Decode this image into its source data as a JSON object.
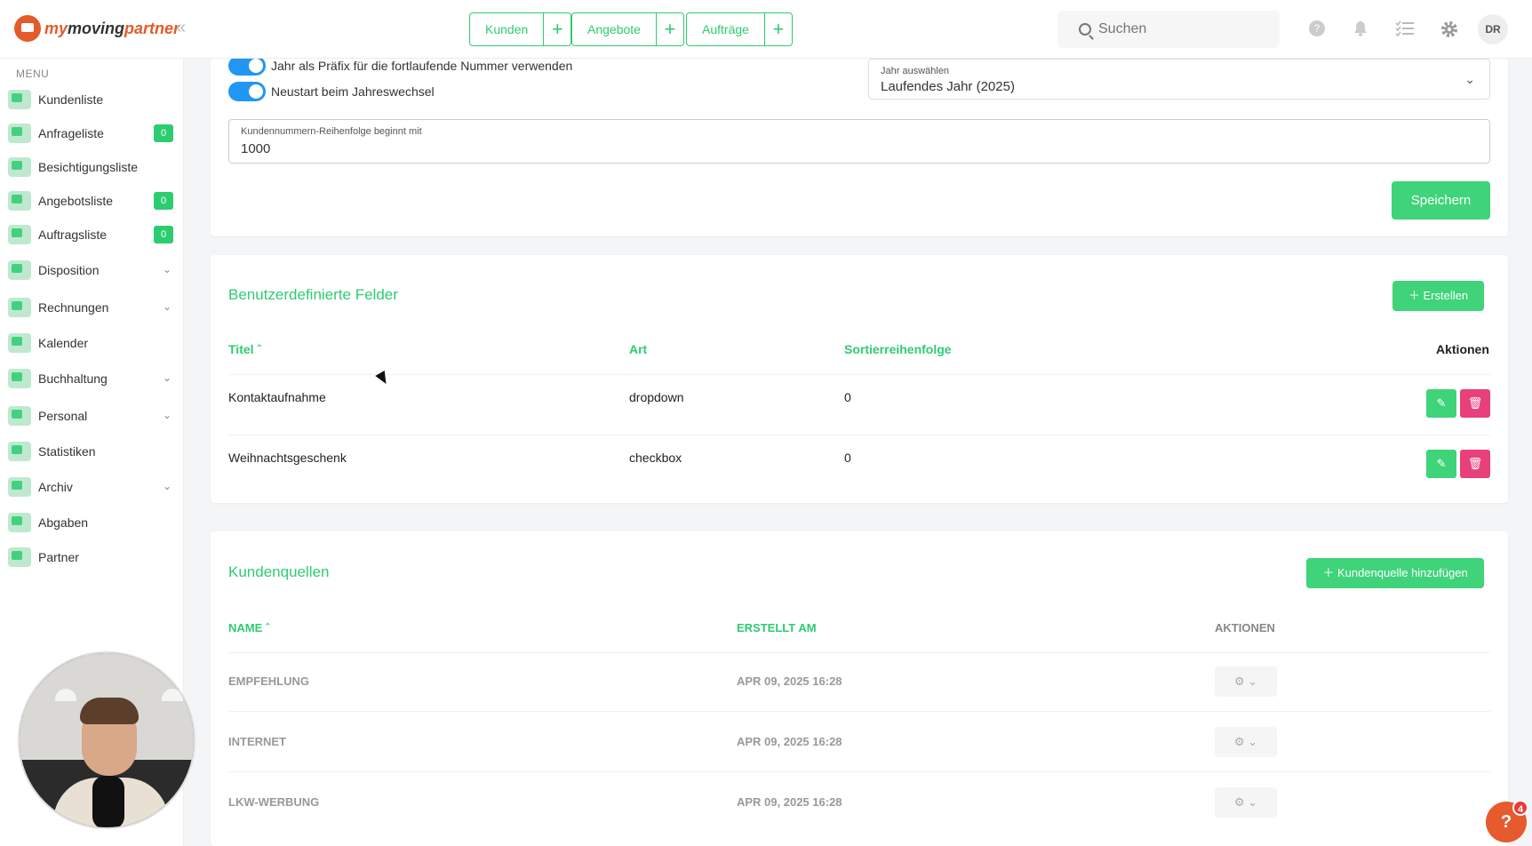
{
  "app": {
    "brand_my": "my",
    "brand_moving": "moving",
    "brand_partner": "partner",
    "collapse": "«"
  },
  "quick": [
    {
      "label": "Kunden",
      "plus": "+"
    },
    {
      "label": "Angebote",
      "plus": "+"
    },
    {
      "label": "Aufträge",
      "plus": "+"
    }
  ],
  "search": {
    "placeholder": "Suchen"
  },
  "user": {
    "initials": "DR"
  },
  "sidebar": {
    "heading": "MENU",
    "items": [
      {
        "label": "Kundenliste"
      },
      {
        "label": "Anfrageliste",
        "badge": "0"
      },
      {
        "label": "Besichtigungsliste"
      },
      {
        "label": "Angebotsliste",
        "badge": "0"
      },
      {
        "label": "Auftragsliste",
        "badge": "0"
      },
      {
        "label": "Disposition"
      },
      {
        "label": "Rechnungen"
      },
      {
        "label": "Kalender"
      },
      {
        "label": "Buchhaltung"
      },
      {
        "label": "Personal"
      },
      {
        "label": "Statistiken"
      },
      {
        "label": "Archiv"
      },
      {
        "label": "Abgaben"
      },
      {
        "label": "Partner"
      }
    ]
  },
  "numbering": {
    "toggle1_label": "Jahr als Präfix für die fortlaufende Nummer verwenden",
    "toggle2_label": "Neustart beim Jahreswechsel",
    "year_label": "Jahr auswählen",
    "year_value": "Laufendes Jahr (2025)",
    "start_label": "Kundennummern-Reihenfolge beginnt mit",
    "start_value": "1000",
    "save": "Speichern"
  },
  "custom_fields": {
    "title": "Benutzerdefinierte Felder",
    "create": "Erstellen",
    "headers": {
      "title": "Titel",
      "type": "Art",
      "order": "Sortierreihenfolge",
      "actions": "Aktionen"
    },
    "rows": [
      {
        "title": "Kontaktaufnahme",
        "type": "dropdown",
        "order": "0"
      },
      {
        "title": "Weihnachtsgeschenk",
        "type": "checkbox",
        "order": "0"
      }
    ]
  },
  "sources": {
    "title": "Kundenquellen",
    "add": "Kundenquelle hinzufügen",
    "headers": {
      "name": "NAME",
      "created": "ERSTELLT AM",
      "actions": "AKTIONEN"
    },
    "rows": [
      {
        "name": "EMPFEHLUNG",
        "created": "APR 09, 2025 16:28"
      },
      {
        "name": "INTERNET",
        "created": "APR 09, 2025 16:28"
      },
      {
        "name": "LKW-WERBUNG",
        "created": "APR 09, 2025 16:28"
      }
    ]
  },
  "help": {
    "icon": "?",
    "count": "4"
  }
}
